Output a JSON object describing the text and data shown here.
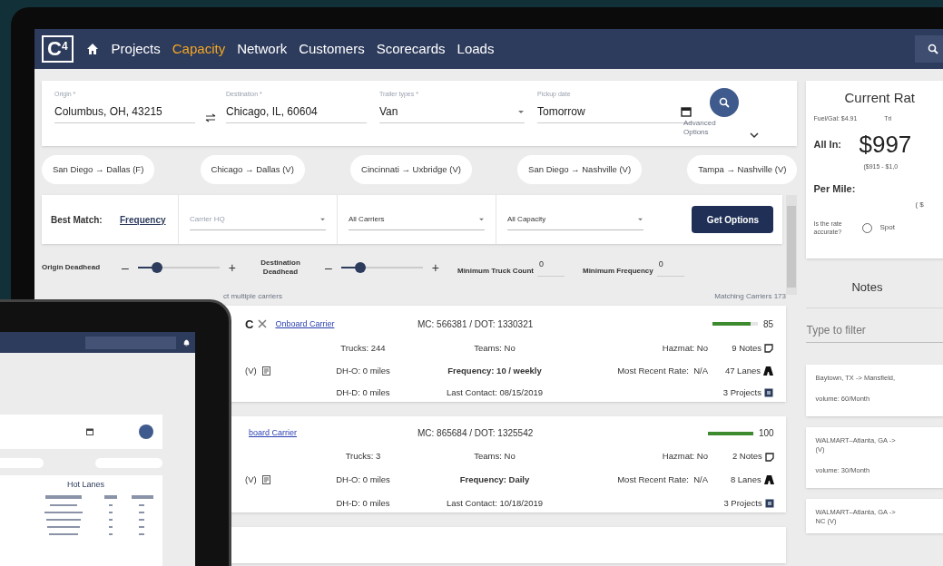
{
  "nav": {
    "logo": "C",
    "logo_sup": "4",
    "tabs": [
      {
        "label": "Projects",
        "selected": false
      },
      {
        "label": "Capacity",
        "selected": true
      },
      {
        "label": "Network",
        "selected": false
      },
      {
        "label": "Customers",
        "selected": false
      },
      {
        "label": "Scorecards",
        "selected": false
      },
      {
        "label": "Loads",
        "selected": false
      }
    ]
  },
  "search": {
    "fields": [
      {
        "label": "Origin *",
        "value": "Columbus, OH, 43215",
        "kind": "text"
      },
      {
        "label": "Destination *",
        "value": "Chicago, IL, 60604",
        "kind": "text"
      },
      {
        "label": "Trailer types *",
        "value": "Van",
        "kind": "select"
      },
      {
        "label": "Pickup date",
        "value": "Tomorrow",
        "kind": "date"
      }
    ],
    "advanced": "Advanced Options"
  },
  "chips": [
    "San Diego → Dallas (F)",
    "Chicago → Dallas (V)",
    "Cincinnati → Uxbridge (V)",
    "San Diego → Nashville (V)",
    "Tampa → Nashville (V)"
  ],
  "filters": {
    "label": "Best Match:",
    "sort": "Frequency",
    "selects": [
      {
        "placeholder": "Carrier HQ"
      },
      {
        "value": "All Carriers"
      },
      {
        "value": "All Capacity"
      }
    ],
    "button": "Get Options"
  },
  "sliders": [
    {
      "label": "Origin Deadhead",
      "minus": "–",
      "plus": "+",
      "level": 0.2
    },
    {
      "label": "Destination Deadhead",
      "minus": "–",
      "plus": "+",
      "level": 0.2
    }
  ],
  "minimums": [
    {
      "label": "Minimum Truck Count",
      "value": "0"
    },
    {
      "label": "Minimum Frequency",
      "value": "0"
    }
  ],
  "hint": "ct multiple carriers",
  "matching": "Matching Carriers 173",
  "carriers": [
    {
      "name": "C",
      "link": "Onboard Carrier",
      "mc": "MC: 566381 / DOT: 1330321",
      "score": "85",
      "level": 0.85,
      "lane": "(V)",
      "trucks": "Trucks: 244",
      "teams": "Teams: No",
      "hazmat": "Hazmat: No",
      "notes": "9 Notes",
      "dho": "DH-O: 0 miles",
      "frequency": "Frequency: 10 / weekly",
      "rate": "Most Recent Rate:  N/A",
      "lanes": "47 Lanes",
      "dhd": "DH-D: 0 miles",
      "contact": "Last Contact: 08/15/2019",
      "projects": "3 Projects"
    },
    {
      "link": "board Carrier",
      "mc": "MC: 865684 / DOT: 1325542",
      "score": "100",
      "level": 1,
      "lane": "(V)",
      "trucks": "Trucks: 3",
      "teams": "Teams: No",
      "hazmat": "Hazmat: No",
      "notes": "2 Notes",
      "dho": "DH-O: 0 miles",
      "frequency": "Frequency: Daily",
      "rate": "Most Recent Rate:  N/A",
      "lanes": "8 Lanes",
      "dhd": "DH-D: 0 miles",
      "contact": "Last Contact: 10/18/2019",
      "projects": "3 Projects"
    }
  ],
  "rate": {
    "title": "Current Rat",
    "fuel": "Fuel/Gal: $4.91",
    "trip": "Tri",
    "all_in_label": "All In:",
    "all_in": "$997",
    "range": "($915 - $1,0",
    "per_mile_label": "Per Mile:",
    "per_mile_range": "( $",
    "question": "Is the rate accurate?",
    "option": {
      "label": "Spot",
      "selected": false
    }
  },
  "notes": {
    "title": "Notes",
    "placeholder": "Type to filter",
    "items": [
      {
        "lines": [
          "Baytown, TX -> Mansfield, "
        ],
        "volume": "volume: 60/Month"
      },
      {
        "lines": [
          "WALMART–Atlanta, GA -> ",
          "(V)"
        ],
        "volume": "volume: 30/Month"
      },
      {
        "lines": [
          "WALMART–Atlanta, GA -> ",
          "NC (V)"
        ]
      }
    ]
  },
  "tablet": {
    "hot_lanes": "Hot Lanes"
  }
}
